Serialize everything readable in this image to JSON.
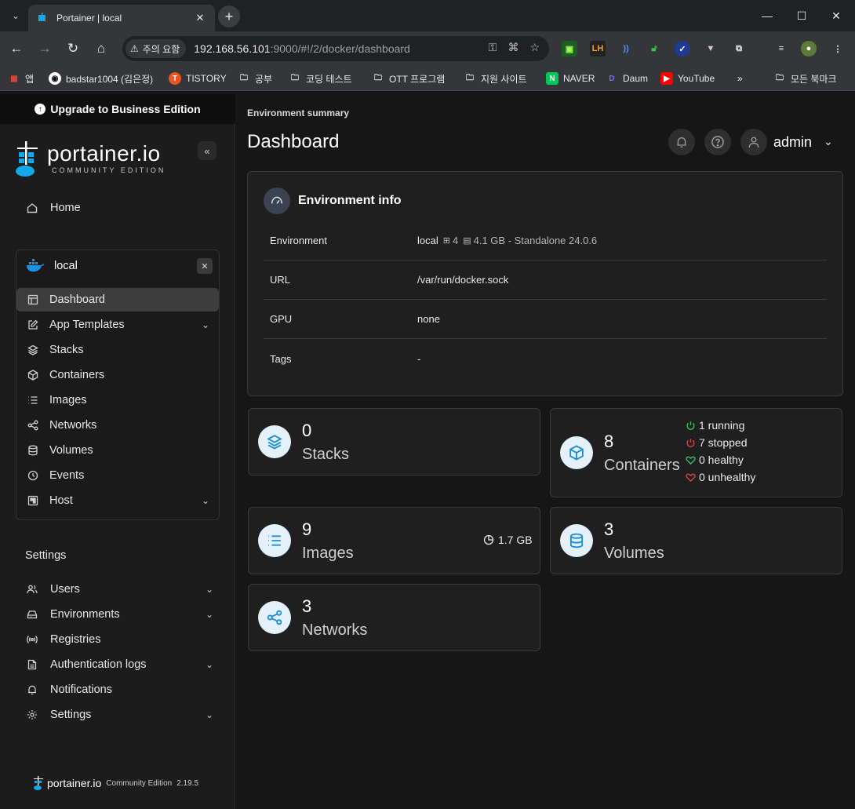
{
  "browser": {
    "tab_title": "Portainer | local",
    "security_label": "주의 요함",
    "url_host": "192.168.56.101",
    "url_rest": ":9000/#!/2/docker/dashboard",
    "bookmarks": [
      {
        "label": "앱",
        "icon": "apps-grid-icon"
      },
      {
        "label": "badstar1004 (김은정)",
        "icon": "github-icon"
      },
      {
        "label": "TISTORY",
        "icon": "tistory-icon"
      },
      {
        "label": "공부",
        "icon": "folder-icon"
      },
      {
        "label": "코딩 테스트",
        "icon": "folder-icon"
      },
      {
        "label": "OTT 프로그램",
        "icon": "folder-icon"
      },
      {
        "label": "지원 사이트",
        "icon": "folder-icon"
      },
      {
        "label": "NAVER",
        "icon": "naver-icon"
      },
      {
        "label": "Daum",
        "icon": "daum-icon"
      },
      {
        "label": "YouTube",
        "icon": "youtube-icon"
      }
    ],
    "all_bookmarks": "모든 북마크"
  },
  "sidebar": {
    "upgrade_label": "Upgrade to Business Edition",
    "logo_main": "portainer.io",
    "logo_sub": "COMMUNITY EDITION",
    "home_label": "Home",
    "environment": {
      "name": "local",
      "items": [
        {
          "label": "Dashboard",
          "icon": "dashboard-icon",
          "active": true,
          "expandable": false
        },
        {
          "label": "App Templates",
          "icon": "edit-icon",
          "active": false,
          "expandable": true
        },
        {
          "label": "Stacks",
          "icon": "layers-icon",
          "active": false,
          "expandable": false
        },
        {
          "label": "Containers",
          "icon": "box-icon",
          "active": false,
          "expandable": false
        },
        {
          "label": "Images",
          "icon": "list-icon",
          "active": false,
          "expandable": false
        },
        {
          "label": "Networks",
          "icon": "share-icon",
          "active": false,
          "expandable": false
        },
        {
          "label": "Volumes",
          "icon": "database-icon",
          "active": false,
          "expandable": false
        },
        {
          "label": "Events",
          "icon": "clock-icon",
          "active": false,
          "expandable": false
        },
        {
          "label": "Host",
          "icon": "host-icon",
          "active": false,
          "expandable": true
        }
      ]
    },
    "settings_title": "Settings",
    "settings_items": [
      {
        "label": "Users",
        "icon": "users-icon",
        "expandable": true
      },
      {
        "label": "Environments",
        "icon": "hdd-icon",
        "expandable": true
      },
      {
        "label": "Registries",
        "icon": "radio-icon",
        "expandable": false
      },
      {
        "label": "Authentication logs",
        "icon": "file-text-icon",
        "expandable": true
      },
      {
        "label": "Notifications",
        "icon": "bell-icon",
        "expandable": false
      },
      {
        "label": "Settings",
        "icon": "gear-icon",
        "expandable": true
      }
    ],
    "footer": {
      "name": "portainer.io",
      "edition": "Community Edition",
      "version": "2.19.5"
    }
  },
  "main": {
    "breadcrumb": "Environment summary",
    "title": "Dashboard",
    "user": "admin",
    "env_info": {
      "title": "Environment info",
      "rows": [
        {
          "label": "Environment",
          "value": "local",
          "cpu": "4",
          "mem": "4.1 GB - Standalone 24.0.6"
        },
        {
          "label": "URL",
          "value": "/var/run/docker.sock"
        },
        {
          "label": "GPU",
          "value": "none"
        },
        {
          "label": "Tags",
          "value": "-"
        }
      ]
    },
    "stats": {
      "stacks": {
        "count": "0",
        "label": "Stacks"
      },
      "containers": {
        "count": "8",
        "label": "Containers",
        "running": "1 running",
        "stopped": "7 stopped",
        "healthy": "0 healthy",
        "unhealthy": "0 unhealthy"
      },
      "images": {
        "count": "9",
        "label": "Images",
        "size": "1.7 GB"
      },
      "volumes": {
        "count": "3",
        "label": "Volumes"
      },
      "networks": {
        "count": "3",
        "label": "Networks"
      }
    }
  },
  "colors": {
    "accent": "#1a8fd4",
    "running": "#34c36a",
    "stopped": "#d64545",
    "healthy": "#34c36a",
    "unhealthy": "#d64545"
  }
}
